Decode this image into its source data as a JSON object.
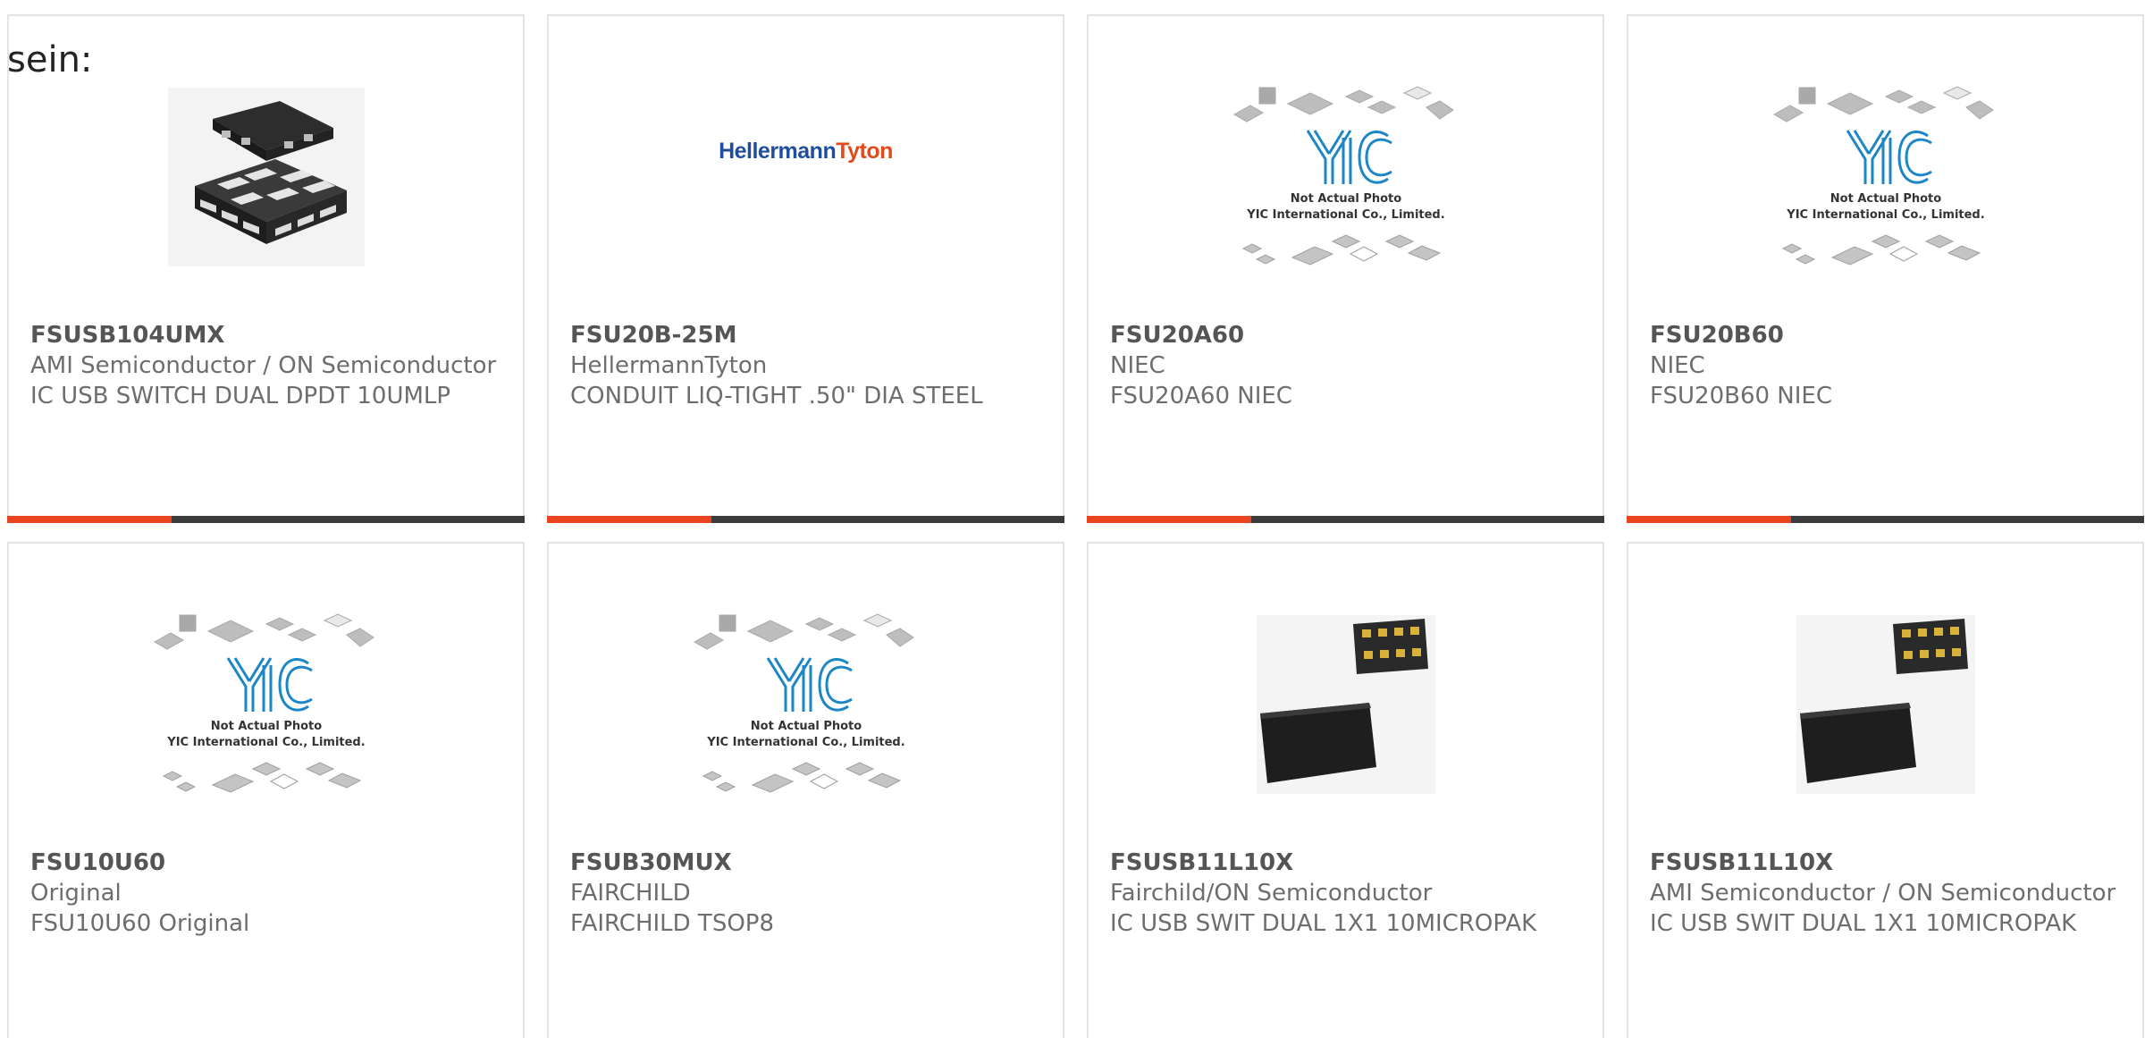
{
  "intro_text": "sein:",
  "colors": {
    "accent": "#e8451e",
    "bar": "#3b3b3b",
    "border": "#e3e3e3",
    "text": "#6d6d6d"
  },
  "products": [
    {
      "part": "FSUSB104UMX",
      "manufacturer": "AMI Semiconductor / ON Semiconductor",
      "description": "IC USB SWITCH DUAL DPDT 10UMLP",
      "image": "qfn-chip-photo"
    },
    {
      "part": "FSU20B-25M",
      "manufacturer": "HellermannTyton",
      "description": "CONDUIT LIQ-TIGHT .50\" DIA STEEL",
      "image": "hellermanntyton-logo",
      "logo_text_a": "Hellermann",
      "logo_text_b": "Tyton"
    },
    {
      "part": "FSU20A60",
      "manufacturer": "NIEC",
      "description": "FSU20A60 NIEC",
      "image": "yic-placeholder"
    },
    {
      "part": "FSU20B60",
      "manufacturer": "NIEC",
      "description": "FSU20B60 NIEC",
      "image": "yic-placeholder"
    },
    {
      "part": "FSU10U60",
      "manufacturer": "Original",
      "description": "FSU10U60 Original",
      "image": "yic-placeholder"
    },
    {
      "part": "FSUB30MUX",
      "manufacturer": "FAIRCHILD",
      "description": "FAIRCHILD TSOP8",
      "image": "yic-placeholder"
    },
    {
      "part": "FSUSB11L10X",
      "manufacturer": "Fairchild/ON Semiconductor",
      "description": "IC USB SWIT DUAL 1X1 10MICROPAK",
      "image": "micropak-chip-photo"
    },
    {
      "part": "FSUSB11L10X",
      "manufacturer": "AMI Semiconductor / ON Semiconductor",
      "description": "IC USB SWIT DUAL 1X1 10MICROPAK",
      "image": "micropak-chip-photo"
    }
  ],
  "yic": {
    "logo": "YIC",
    "line1": "Not Actual Photo",
    "line2": "YIC International Co., Limited."
  }
}
